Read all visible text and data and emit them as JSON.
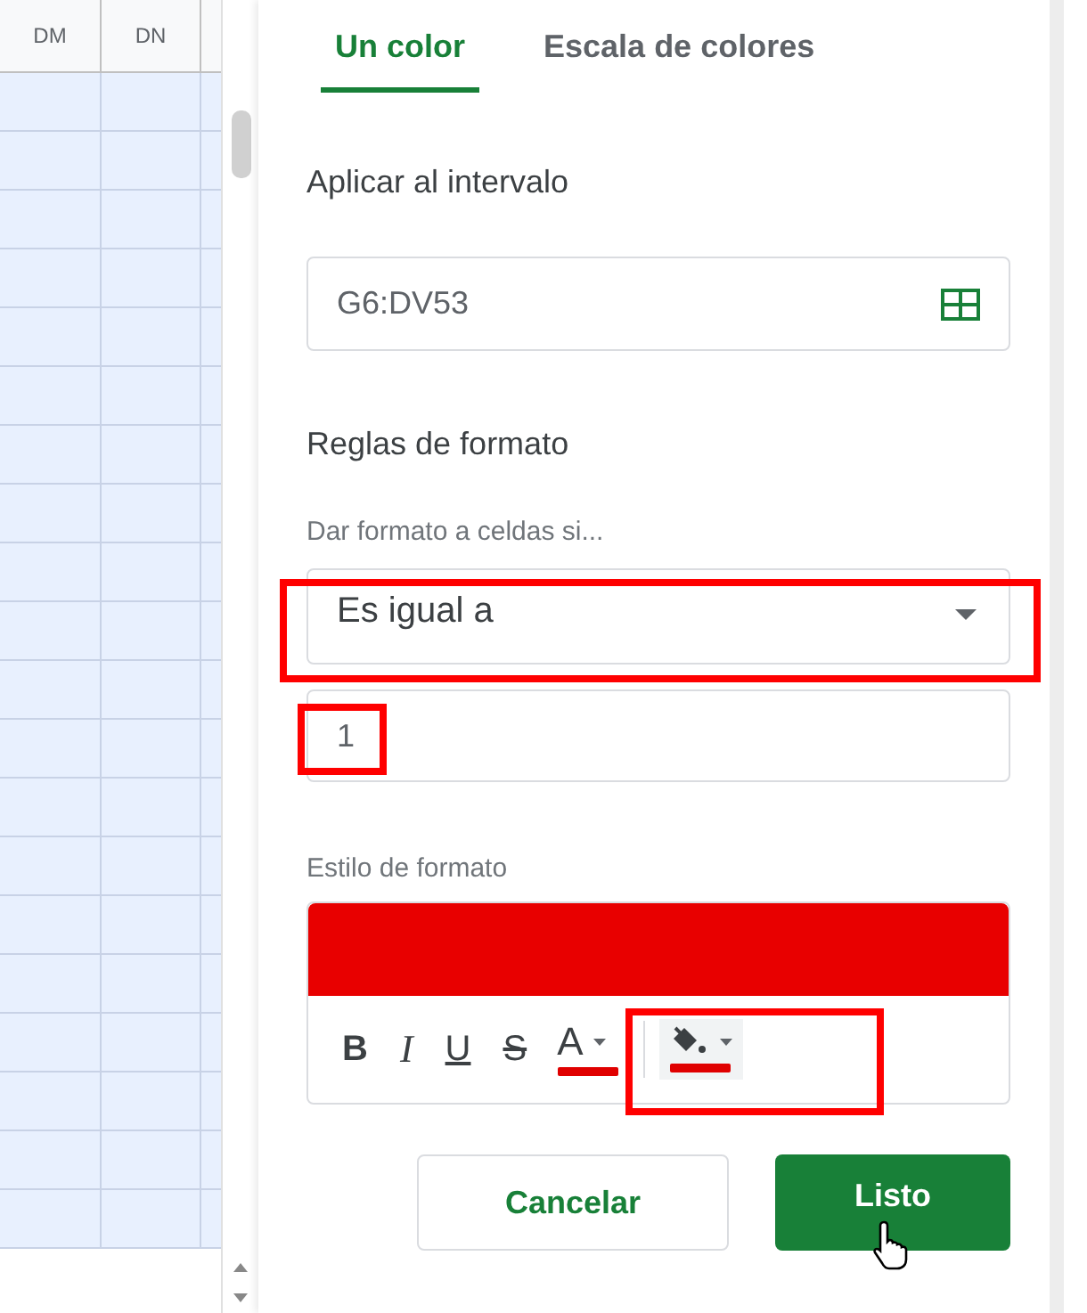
{
  "sheet": {
    "columns": [
      {
        "label": "DM"
      },
      {
        "label": "DN"
      }
    ]
  },
  "tabs": [
    {
      "label": "Un color",
      "selected": true
    },
    {
      "label": "Escala de colores",
      "selected": false
    }
  ],
  "range": {
    "label": "Aplicar al intervalo",
    "value": "G6:DV53"
  },
  "rules": {
    "title": "Reglas de formato",
    "condition_label": "Dar formato a celdas si...",
    "condition": {
      "value": "Es igual a",
      "highlighted": true
    },
    "value_field": {
      "value": "1",
      "highlighted": true
    }
  },
  "style": {
    "label": "Estilo de formato",
    "tools": [
      {
        "kind": "bold",
        "label": "B"
      },
      {
        "kind": "italic",
        "label": "I"
      },
      {
        "kind": "underline",
        "label": "U"
      },
      {
        "kind": "strike",
        "label": "S"
      },
      {
        "kind": "text_color",
        "label": "A",
        "color": "#e00000"
      },
      {
        "kind": "fill_color",
        "color": "#e00000"
      }
    ],
    "colors_highlighted": true
  },
  "buttons": [
    {
      "label": "Cancelar",
      "kind": "secondary"
    },
    {
      "label": "Listo",
      "kind": "primary"
    }
  ]
}
